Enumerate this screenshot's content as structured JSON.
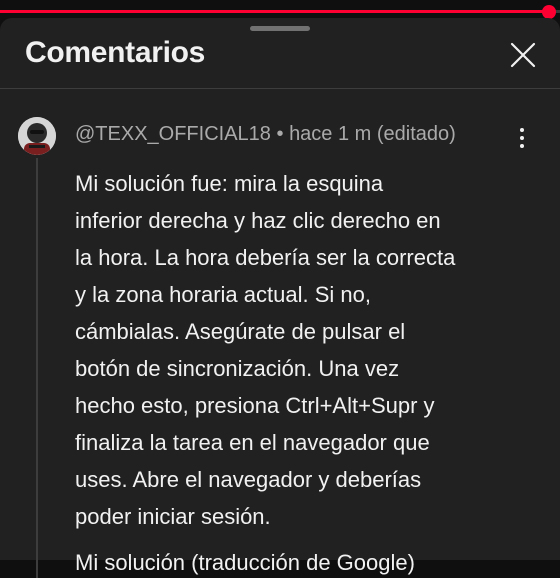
{
  "progress": {
    "fraction": 0.98,
    "color": "#ff0033"
  },
  "header": {
    "title": "Comentarios",
    "close_icon": "close-icon"
  },
  "comment": {
    "author": "@TEXX_OFFICIAL18",
    "separator": "•",
    "time": "hace 1 m (editado)",
    "more_icon": "more-vert-icon",
    "lines": [
      "Mi solución fue: mira la esquina",
      "inferior derecha y haz clic derecho en",
      "la hora. La hora debería ser la correcta",
      "y la zona horaria actual. Si no,",
      "cámbialas. Asegúrate de pulsar el",
      "botón de sincronización. Una vez",
      "hecho esto, presiona Ctrl+Alt+Supr y",
      "finaliza la tarea en el navegador que",
      "uses. Abre el navegador y deberías",
      "poder iniciar sesión."
    ]
  },
  "next_comment_partial": "Mi solución (traducción de Google)"
}
